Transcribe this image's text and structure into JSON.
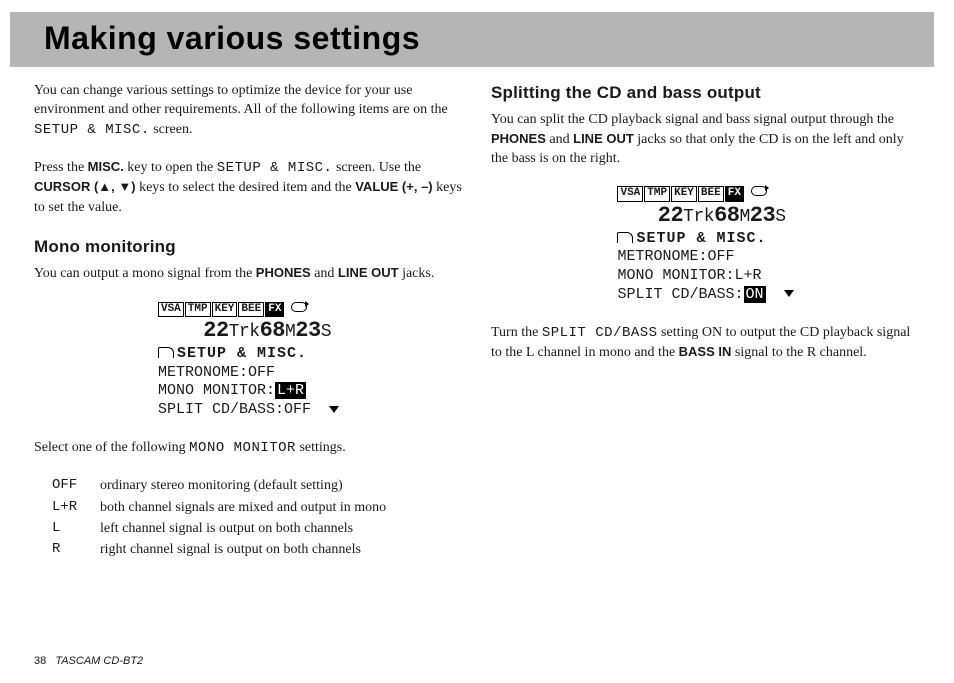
{
  "title": "Making various settings",
  "intro": {
    "p1a": "You can change various settings to optimize the device for your use environment and other requirements. All of the following items are on the ",
    "p1_screen": "SETUP & MISC.",
    "p1b": " screen.",
    "p2a": "Press the ",
    "p2_misc": "MISC.",
    "p2b": " key to open the ",
    "p2_screen": "SETUP & MISC.",
    "p2c": " screen. Use the ",
    "p2_cursor": "CURSOR (▲, ▼)",
    "p2d": " keys to select the desired item and the ",
    "p2_value": "VALUE (+, –)",
    "p2e": " keys to set the value."
  },
  "mono": {
    "heading": "Mono monitoring",
    "p1a": "You can output a mono signal from the ",
    "p1_phones": "PHONES",
    "p1b": " and ",
    "p1_lineout": "LINE OUT",
    "p1c": " jacks.",
    "screen": {
      "tabs": [
        "VSA",
        "TMP",
        "KEY",
        "BEE",
        "FX"
      ],
      "active_tab": 4,
      "time_trk": "22",
      "time_m": "68",
      "time_s": "23",
      "title": "SETUP & MISC.",
      "row1": "METRONOME:OFF",
      "row2_label": "MONO MONITOR:",
      "row2_val": "L+R",
      "row3": "SPLIT CD/BASS:OFF"
    },
    "p2a": "Select one of the following ",
    "p2_mono": "MONO MONITOR",
    "p2b": " settings.",
    "options": [
      {
        "key": "OFF",
        "desc": "ordinary stereo monitoring (default setting)"
      },
      {
        "key": "L+R",
        "desc": "both channel signals are mixed and output in mono"
      },
      {
        "key": "L",
        "desc": "left channel signal is output on both channels"
      },
      {
        "key": "R",
        "desc": "right channel signal is output on both channels"
      }
    ]
  },
  "split": {
    "heading": "Splitting the CD and bass output",
    "p1a": "You can split the CD playback signal and bass signal output through the ",
    "p1_phones": "PHONES",
    "p1b": " and ",
    "p1_lineout": "LINE OUT",
    "p1c": " jacks so that only the CD is on the left and only the bass is on the right.",
    "screen": {
      "tabs": [
        "VSA",
        "TMP",
        "KEY",
        "BEE",
        "FX"
      ],
      "active_tab": 4,
      "time_trk": "22",
      "time_m": "68",
      "time_s": "23",
      "title": "SETUP & MISC.",
      "row1": "METRONOME:OFF",
      "row2": "MONO MONITOR:L+R",
      "row3_label": "SPLIT CD/BASS:",
      "row3_val": "ON"
    },
    "p2a": "Turn the ",
    "p2_split": "SPLIT CD/BASS",
    "p2b": " setting ON to output the CD playback signal to the L channel in mono and the ",
    "p2_bassin": "BASS IN",
    "p2c": " signal to the R channel."
  },
  "footer": {
    "page": "38",
    "product": "TASCAM  CD-BT2"
  }
}
